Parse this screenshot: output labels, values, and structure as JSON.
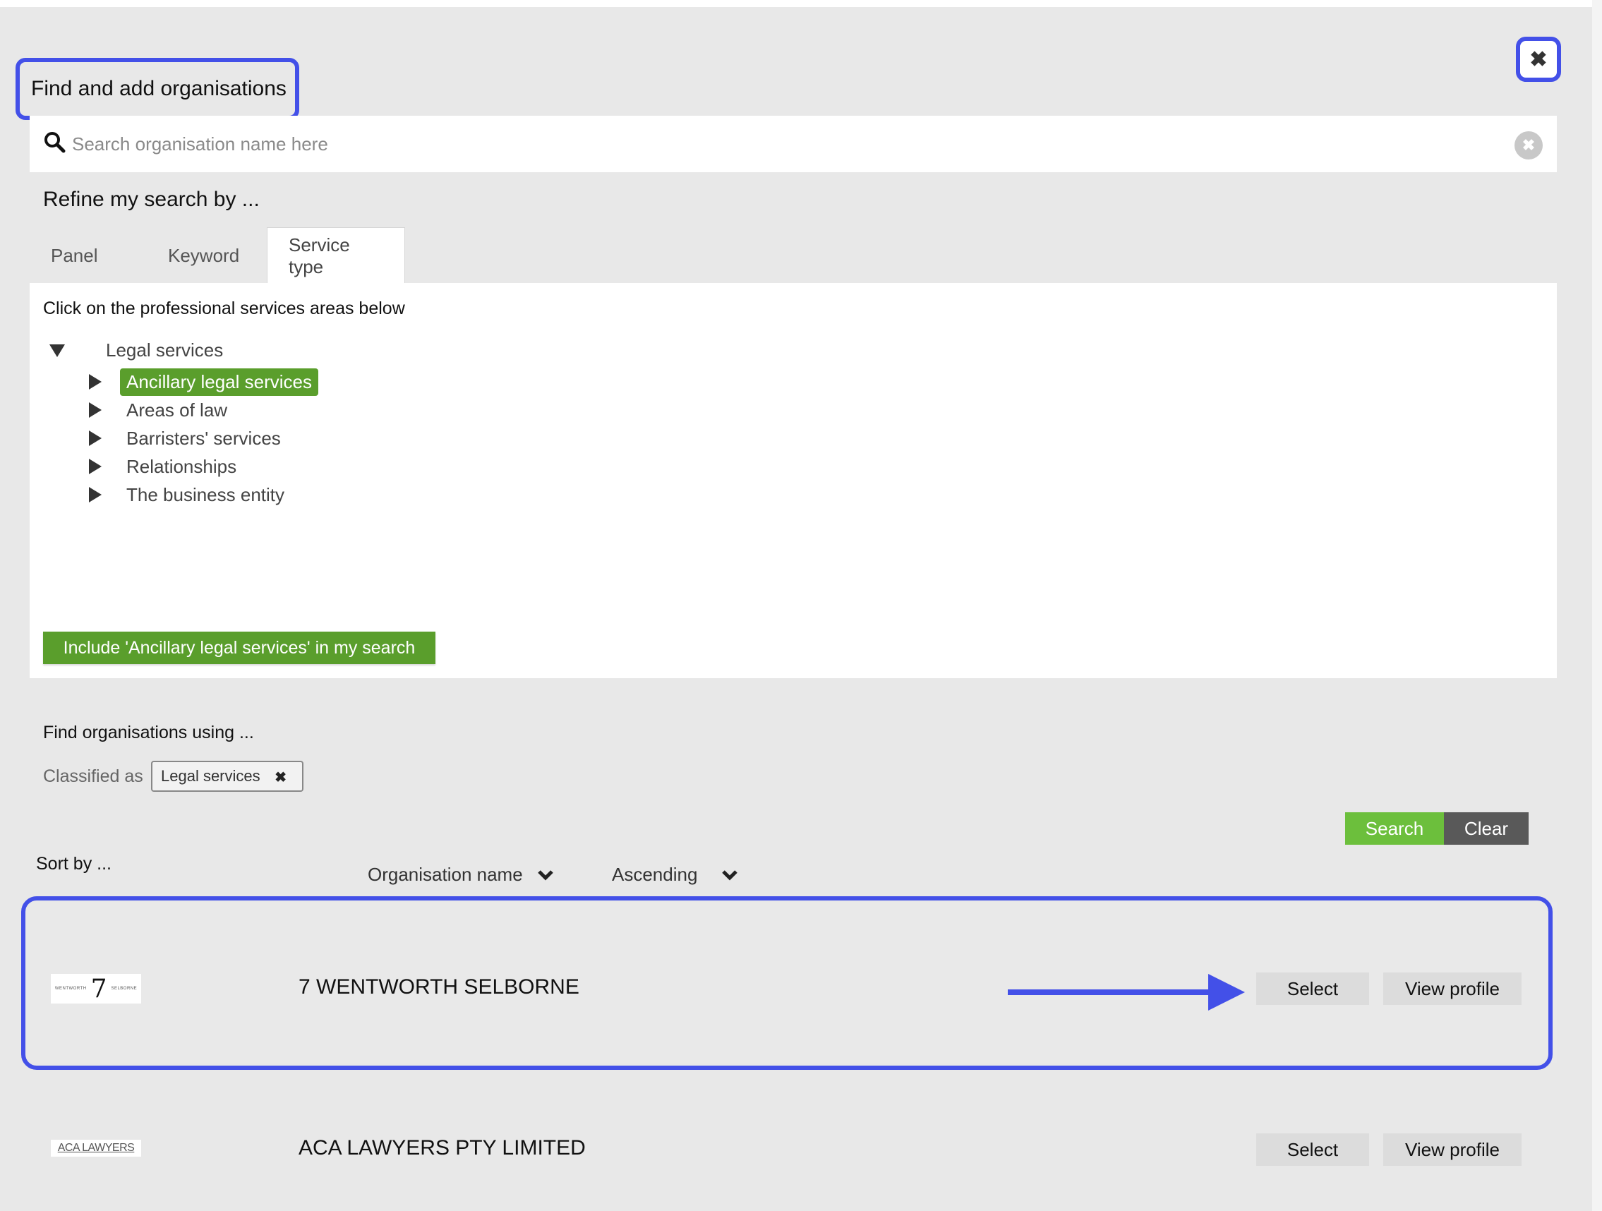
{
  "modal": {
    "title": "Find and add organisations",
    "close_icon": "close-icon",
    "highlight_color": "#4350e8"
  },
  "search": {
    "placeholder": "Search organisation name here",
    "value": ""
  },
  "refine": {
    "title": "Refine my search by ...",
    "tabs": [
      {
        "label": "Panel",
        "active": false
      },
      {
        "label": "Keyword",
        "active": false
      },
      {
        "label": "Service type",
        "active": true
      }
    ],
    "instruction": "Click on the professional services areas below",
    "tree": {
      "root": {
        "label": "Legal services",
        "expanded": true
      },
      "children": [
        {
          "label": "Ancillary legal services",
          "selected": true
        },
        {
          "label": "Areas of law",
          "selected": false
        },
        {
          "label": "Barristers' services",
          "selected": false
        },
        {
          "label": "Relationships",
          "selected": false
        },
        {
          "label": "The business entity",
          "selected": false
        }
      ]
    },
    "include_button": "Include 'Ancillary legal services' in my search",
    "accent_color": "#5a9e2c"
  },
  "find": {
    "title": "Find organisations using ...",
    "classified_label": "Classified as",
    "chip": "Legal services",
    "chip_remove": "✖"
  },
  "actions": {
    "search": "Search",
    "clear": "Clear"
  },
  "sort": {
    "label": "Sort by ...",
    "field": "Organisation name",
    "order": "Ascending"
  },
  "results": [
    {
      "name": "7 WENTWORTH SELBORNE",
      "logo_text": {
        "left": "WENTWORTH",
        "big": "7",
        "right": "SELBORNE"
      },
      "select": "Select",
      "view": "View profile",
      "highlighted": true
    },
    {
      "name": "ACA LAWYERS PTY LIMITED",
      "logo_text": {
        "text": "ACA LAWYERS"
      },
      "select": "Select",
      "view": "View profile",
      "highlighted": false
    }
  ]
}
